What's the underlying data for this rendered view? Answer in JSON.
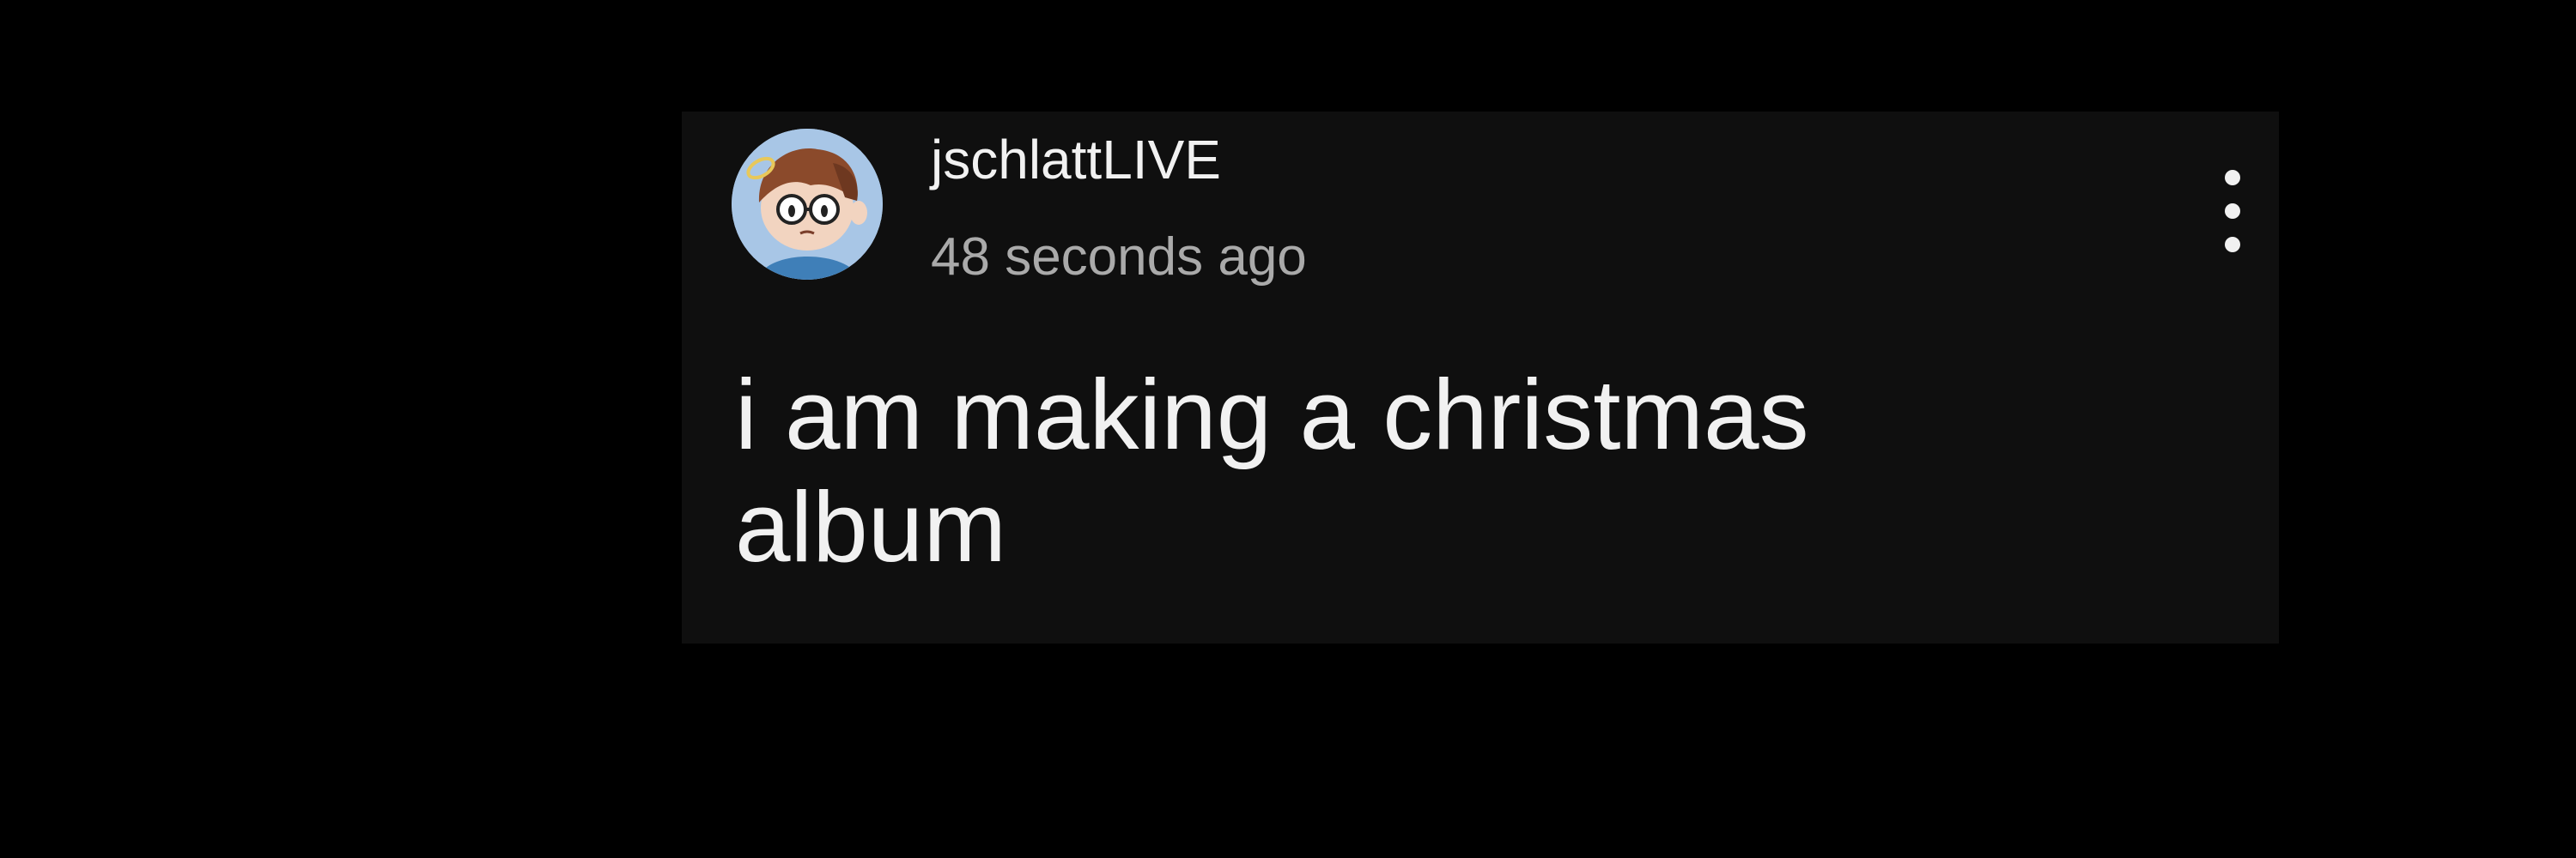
{
  "comment": {
    "author": "jschlattLIVE",
    "timestamp": "48 seconds ago",
    "text": "i am making a christmas album",
    "avatar_icon": "cartoon-avatar-icon",
    "menu_icon": "more-vertical-icon"
  },
  "colors": {
    "page_background": "#000000",
    "card_background": "#0f0f0f",
    "primary_text": "#f1f1f1",
    "secondary_text": "#aaaaaa",
    "avatar_background": "#a8c6e6"
  }
}
